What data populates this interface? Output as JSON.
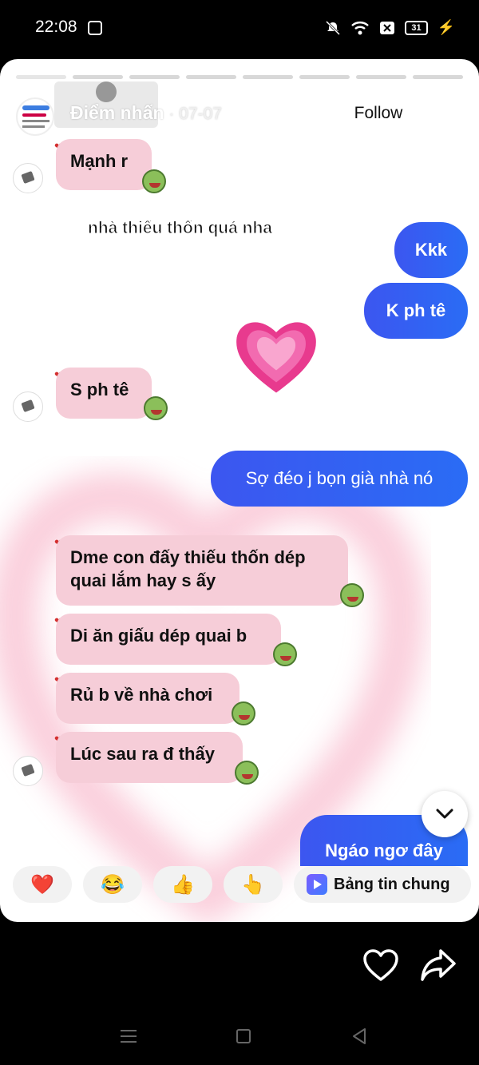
{
  "status_bar": {
    "time": "22:08",
    "battery": "31"
  },
  "story": {
    "username": "Điểm nhấn",
    "date_separator": " · ",
    "date": "07-07",
    "follow_label": "Follow"
  },
  "caption": "nhà thiếu thốn quá nha",
  "messages": [
    {
      "side": "in",
      "text": "Mạnh r"
    },
    {
      "side": "out",
      "text": "Kkk"
    },
    {
      "side": "out",
      "text": "K ph tê"
    },
    {
      "side": "in",
      "text": "S ph tê"
    },
    {
      "side": "out",
      "text": "Sợ đéo j bọn già nhà nó"
    },
    {
      "side": "in",
      "text": "Dme con đấy thiếu thốn dép quai lắm hay s ấy"
    },
    {
      "side": "in",
      "text": "Di ăn giấu dép quai b"
    },
    {
      "side": "in",
      "text": "Rủ b về nhà chơi"
    },
    {
      "side": "in",
      "text": "Lúc sau ra đ thấy"
    },
    {
      "side": "out",
      "text": "Ngáo ngơ đây"
    }
  ],
  "reactions": [
    {
      "emoji": "❤️",
      "name": "heart"
    },
    {
      "emoji": "😂",
      "name": "laugh"
    },
    {
      "emoji": "👍",
      "name": "thumbs-up"
    },
    {
      "emoji": "👆",
      "name": "point-up"
    }
  ],
  "shared_news_label": "Bảng tin chung",
  "colors": {
    "incoming_bubble": "#f6cdd8",
    "outgoing_bubble": "#3c56f0",
    "glow": "#f7a8c0"
  }
}
